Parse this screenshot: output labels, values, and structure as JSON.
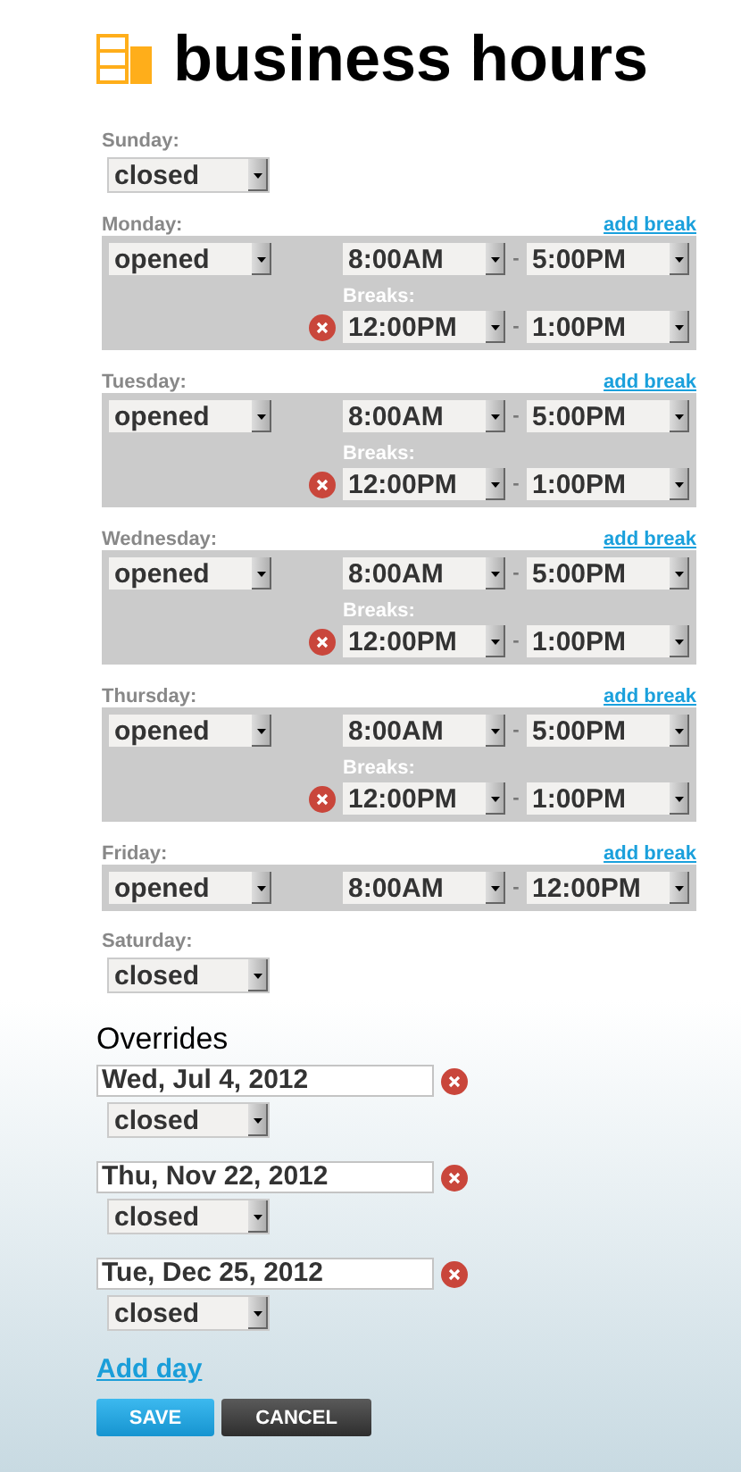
{
  "header": {
    "title": "business hours"
  },
  "days": [
    {
      "label": "Sunday:",
      "kind": "closed",
      "status": "closed"
    },
    {
      "label": "Monday:",
      "kind": "open",
      "status": "opened",
      "add_break": "add break",
      "hours": {
        "from": "8:00AM",
        "dash": "-",
        "to": "5:00PM"
      },
      "breaks_label": "Breaks:",
      "breaks": [
        {
          "from": "12:00PM",
          "dash": "-",
          "to": "1:00PM"
        }
      ]
    },
    {
      "label": "Tuesday:",
      "kind": "open",
      "status": "opened",
      "add_break": "add break",
      "hours": {
        "from": "8:00AM",
        "dash": "-",
        "to": "5:00PM"
      },
      "breaks_label": "Breaks:",
      "breaks": [
        {
          "from": "12:00PM",
          "dash": "-",
          "to": "1:00PM"
        }
      ]
    },
    {
      "label": "Wednesday:",
      "kind": "open",
      "status": "opened",
      "add_break": "add break",
      "hours": {
        "from": "8:00AM",
        "dash": "-",
        "to": "5:00PM"
      },
      "breaks_label": "Breaks:",
      "breaks": [
        {
          "from": "12:00PM",
          "dash": "-",
          "to": "1:00PM"
        }
      ]
    },
    {
      "label": "Thursday:",
      "kind": "open",
      "status": "opened",
      "add_break": "add break",
      "hours": {
        "from": "8:00AM",
        "dash": "-",
        "to": "5:00PM"
      },
      "breaks_label": "Breaks:",
      "breaks": [
        {
          "from": "12:00PM",
          "dash": "-",
          "to": "1:00PM"
        }
      ]
    },
    {
      "label": "Friday:",
      "kind": "open",
      "status": "opened",
      "add_break": "add break",
      "hours": {
        "from": "8:00AM",
        "dash": "-",
        "to": "12:00PM"
      }
    },
    {
      "label": "Saturday:",
      "kind": "closed",
      "status": "closed"
    }
  ],
  "overrides": {
    "heading": "Overrides",
    "items": [
      {
        "date": "Wed, Jul 4, 2012",
        "status": "closed"
      },
      {
        "date": "Thu, Nov 22, 2012",
        "status": "closed"
      },
      {
        "date": "Tue, Dec 25, 2012",
        "status": "closed"
      }
    ],
    "add_day": "Add day"
  },
  "buttons": [
    {
      "label": "SAVE",
      "kind": "primary"
    },
    {
      "label": "CANCEL",
      "kind": "secondary"
    }
  ]
}
